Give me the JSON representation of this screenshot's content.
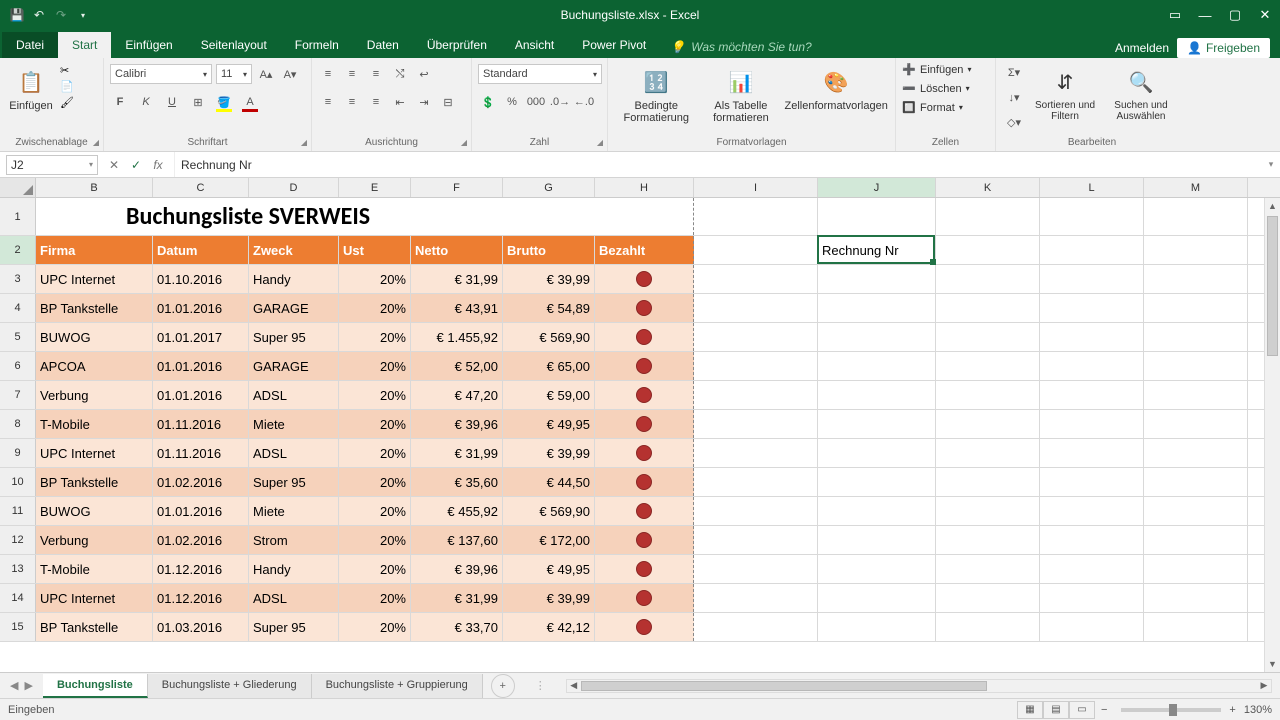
{
  "titlebar": {
    "filename": "Buchungsliste.xlsx - Excel"
  },
  "window": {
    "min": "—",
    "max": "▢",
    "close": "✕",
    "ribopt": "▭"
  },
  "tabs": {
    "file": "Datei",
    "items": [
      "Start",
      "Einfügen",
      "Seitenlayout",
      "Formeln",
      "Daten",
      "Überprüfen",
      "Ansicht",
      "Power Pivot"
    ],
    "active": 0,
    "tellme": "Was möchten Sie tun?",
    "signin": "Anmelden",
    "share": "Freigeben"
  },
  "ribbon": {
    "clipboard": {
      "label": "Zwischenablage",
      "paste": "Einfügen"
    },
    "font": {
      "label": "Schriftart",
      "name": "Calibri",
      "size": "11",
      "bold": "F",
      "italic": "K",
      "underline": "U"
    },
    "align": {
      "label": "Ausrichtung"
    },
    "number": {
      "label": "Zahl",
      "format": "Standard"
    },
    "styles": {
      "label": "Formatvorlagen",
      "cond": "Bedingte Formatierung",
      "table": "Als Tabelle formatieren",
      "cellstyles": "Zellenformatvorlagen"
    },
    "cells": {
      "label": "Zellen",
      "insert": "Einfügen",
      "delete": "Löschen",
      "format": "Format"
    },
    "editing": {
      "label": "Bearbeiten",
      "sort": "Sortieren und Filtern",
      "find": "Suchen und Auswählen"
    }
  },
  "namebox": "J2",
  "fx": {
    "cancel": "✕",
    "enter": "✓",
    "fx": "fx"
  },
  "formula": "Rechnung Nr",
  "columns": [
    "B",
    "C",
    "D",
    "E",
    "F",
    "G",
    "H",
    "I",
    "J",
    "K",
    "L",
    "M"
  ],
  "grid": {
    "title": "Buchungsliste SVERWEIS",
    "headers": [
      "Firma",
      "Datum",
      "Zweck",
      "Ust",
      "Netto",
      "Brutto",
      "Bezahlt"
    ],
    "j2": "Rechnung Nr",
    "rows": [
      {
        "n": "3",
        "firma": "UPC Internet",
        "datum": "01.10.2016",
        "zweck": "Handy",
        "ust": "20%",
        "netto": "€     31,99",
        "brutto": "€ 39,99"
      },
      {
        "n": "4",
        "firma": "BP Tankstelle",
        "datum": "01.01.2016",
        "zweck": "GARAGE",
        "ust": "20%",
        "netto": "€     43,91",
        "brutto": "€ 54,89"
      },
      {
        "n": "5",
        "firma": "BUWOG",
        "datum": "01.01.2017",
        "zweck": "Super 95",
        "ust": "20%",
        "netto": "€ 1.455,92",
        "brutto": "€ 569,90"
      },
      {
        "n": "6",
        "firma": "APCOA",
        "datum": "01.01.2016",
        "zweck": "GARAGE",
        "ust": "20%",
        "netto": "€     52,00",
        "brutto": "€ 65,00"
      },
      {
        "n": "7",
        "firma": "Verbung",
        "datum": "01.01.2016",
        "zweck": "ADSL",
        "ust": "20%",
        "netto": "€     47,20",
        "brutto": "€ 59,00"
      },
      {
        "n": "8",
        "firma": "T-Mobile",
        "datum": "01.11.2016",
        "zweck": "Miete",
        "ust": "20%",
        "netto": "€     39,96",
        "brutto": "€ 49,95"
      },
      {
        "n": "9",
        "firma": "UPC Internet",
        "datum": "01.11.2016",
        "zweck": "ADSL",
        "ust": "20%",
        "netto": "€     31,99",
        "brutto": "€ 39,99"
      },
      {
        "n": "10",
        "firma": "BP Tankstelle",
        "datum": "01.02.2016",
        "zweck": "Super 95",
        "ust": "20%",
        "netto": "€     35,60",
        "brutto": "€ 44,50"
      },
      {
        "n": "11",
        "firma": "BUWOG",
        "datum": "01.01.2016",
        "zweck": "Miete",
        "ust": "20%",
        "netto": "€   455,92",
        "brutto": "€ 569,90"
      },
      {
        "n": "12",
        "firma": "Verbung",
        "datum": "01.02.2016",
        "zweck": "Strom",
        "ust": "20%",
        "netto": "€   137,60",
        "brutto": "€ 172,00"
      },
      {
        "n": "13",
        "firma": "T-Mobile",
        "datum": "01.12.2016",
        "zweck": "Handy",
        "ust": "20%",
        "netto": "€     39,96",
        "brutto": "€ 49,95"
      },
      {
        "n": "14",
        "firma": "UPC Internet",
        "datum": "01.12.2016",
        "zweck": "ADSL",
        "ust": "20%",
        "netto": "€     31,99",
        "brutto": "€ 39,99"
      },
      {
        "n": "15",
        "firma": "BP Tankstelle",
        "datum": "01.03.2016",
        "zweck": "Super 95",
        "ust": "20%",
        "netto": "€     33,70",
        "brutto": "€ 42,12"
      }
    ]
  },
  "sheets": {
    "items": [
      "Buchungsliste",
      "Buchungsliste + Gliederung",
      "Buchungsliste + Gruppierung"
    ],
    "active": 0
  },
  "status": {
    "mode": "Eingeben",
    "zoom": "130%"
  }
}
